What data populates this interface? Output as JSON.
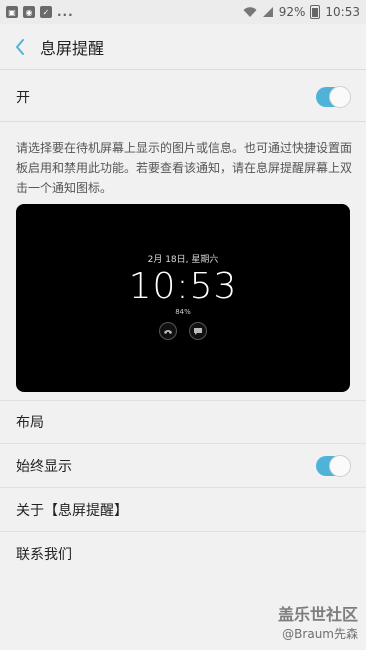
{
  "status_bar": {
    "more": "...",
    "battery_percent": "92%",
    "time": "10:53"
  },
  "header": {
    "title": "息屏提醒"
  },
  "master_toggle": {
    "label": "开",
    "on": true
  },
  "description": "请选择要在待机屏幕上显示的图片或信息。也可通过快捷设置面板启用和禁用此功能。若要查看该通知，请在息屏提醒屏幕上双击一个通知图标。",
  "preview": {
    "date": "2月 18日, 星期六",
    "time": "10:53",
    "battery": "84%"
  },
  "settings": {
    "layout_label": "布局",
    "always_on_label": "始终显示",
    "always_on": true,
    "about_label": "关于【息屏提醒】",
    "contact_label": "联系我们"
  },
  "watermark": {
    "site": "盖乐世社区",
    "user": "@Braum先森"
  },
  "colors": {
    "accent": "#4fb3d9",
    "background": "#f1f1f1"
  }
}
